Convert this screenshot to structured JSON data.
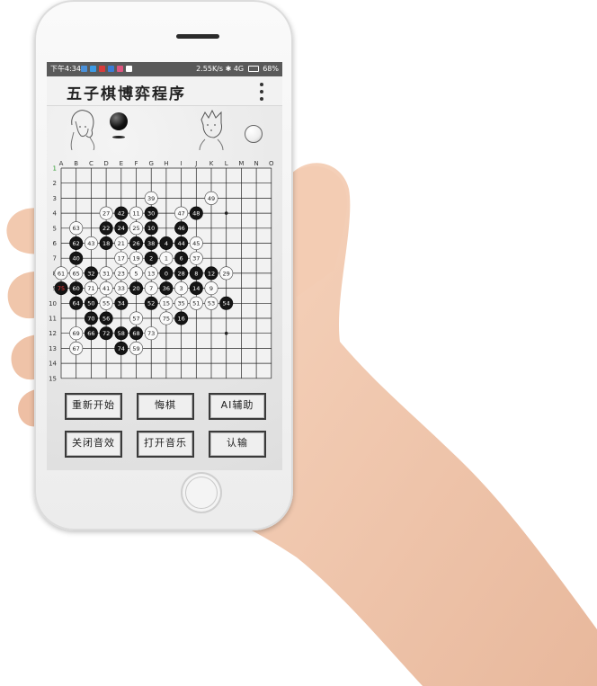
{
  "status_bar": {
    "time": "下午4:34",
    "network": "2.55K/s ✱ 4G",
    "battery": "68%",
    "notification_icons": [
      {
        "name": "message-icon",
        "color": "#4a90d9"
      },
      {
        "name": "app-icon",
        "color": "#3c9be6"
      },
      {
        "name": "mail-icon",
        "color": "#d83b3b"
      },
      {
        "name": "app2-icon",
        "color": "#3a7bd5"
      },
      {
        "name": "app3-icon",
        "color": "#e05580"
      },
      {
        "name": "signal-up-icon",
        "color": "#ffffff"
      }
    ]
  },
  "app": {
    "title": "五子棋博弈程序"
  },
  "players": {
    "player1_stone": "black",
    "player2_stone": "white"
  },
  "board": {
    "columns": [
      "A",
      "B",
      "C",
      "D",
      "E",
      "F",
      "G",
      "H",
      "I",
      "J",
      "K",
      "L",
      "M",
      "N",
      "O"
    ],
    "rows": [
      "1",
      "2",
      "3",
      "4",
      "5",
      "6",
      "7",
      "8",
      "9",
      "10",
      "11",
      "12",
      "13",
      "14",
      "15"
    ],
    "last_move": "75",
    "stones": [
      {
        "n": "39",
        "c": "white",
        "col": "G",
        "row": 3
      },
      {
        "n": "49",
        "c": "white",
        "col": "K",
        "row": 3
      },
      {
        "n": "27",
        "c": "white",
        "col": "D",
        "row": 4
      },
      {
        "n": "42",
        "c": "black",
        "col": "E",
        "row": 4
      },
      {
        "n": "11",
        "c": "white",
        "col": "F",
        "row": 4
      },
      {
        "n": "30",
        "c": "black",
        "col": "G",
        "row": 4
      },
      {
        "n": "47",
        "c": "white",
        "col": "I",
        "row": 4
      },
      {
        "n": "48",
        "c": "black",
        "col": "J",
        "row": 4
      },
      {
        "n": "63",
        "c": "white",
        "col": "B",
        "row": 5
      },
      {
        "n": "22",
        "c": "black",
        "col": "D",
        "row": 5
      },
      {
        "n": "24",
        "c": "black",
        "col": "E",
        "row": 5
      },
      {
        "n": "25",
        "c": "white",
        "col": "F",
        "row": 5
      },
      {
        "n": "10",
        "c": "black",
        "col": "G",
        "row": 5
      },
      {
        "n": "46",
        "c": "black",
        "col": "I",
        "row": 5
      },
      {
        "n": "62",
        "c": "black",
        "col": "B",
        "row": 6
      },
      {
        "n": "43",
        "c": "white",
        "col": "C",
        "row": 6
      },
      {
        "n": "18",
        "c": "black",
        "col": "D",
        "row": 6
      },
      {
        "n": "21",
        "c": "white",
        "col": "E",
        "row": 6
      },
      {
        "n": "26",
        "c": "black",
        "col": "F",
        "row": 6
      },
      {
        "n": "38",
        "c": "black",
        "col": "G",
        "row": 6
      },
      {
        "n": "4",
        "c": "black",
        "col": "H",
        "row": 6
      },
      {
        "n": "44",
        "c": "black",
        "col": "I",
        "row": 6
      },
      {
        "n": "45",
        "c": "white",
        "col": "J",
        "row": 6
      },
      {
        "n": "40",
        "c": "black",
        "col": "B",
        "row": 7
      },
      {
        "n": "17",
        "c": "white",
        "col": "E",
        "row": 7
      },
      {
        "n": "19",
        "c": "white",
        "col": "F",
        "row": 7
      },
      {
        "n": "2",
        "c": "black",
        "col": "G",
        "row": 7
      },
      {
        "n": "1",
        "c": "white",
        "col": "H",
        "row": 7
      },
      {
        "n": "6",
        "c": "black",
        "col": "I",
        "row": 7
      },
      {
        "n": "37",
        "c": "white",
        "col": "J",
        "row": 7
      },
      {
        "n": "61",
        "c": "white",
        "col": "A",
        "row": 8
      },
      {
        "n": "65",
        "c": "white",
        "col": "B",
        "row": 8
      },
      {
        "n": "32",
        "c": "black",
        "col": "C",
        "row": 8
      },
      {
        "n": "31",
        "c": "white",
        "col": "D",
        "row": 8
      },
      {
        "n": "23",
        "c": "white",
        "col": "E",
        "row": 8
      },
      {
        "n": "5",
        "c": "white",
        "col": "F",
        "row": 8
      },
      {
        "n": "13",
        "c": "white",
        "col": "G",
        "row": 8
      },
      {
        "n": "0",
        "c": "black",
        "col": "H",
        "row": 8
      },
      {
        "n": "28",
        "c": "black",
        "col": "I",
        "row": 8
      },
      {
        "n": "8",
        "c": "black",
        "col": "J",
        "row": 8
      },
      {
        "n": "12",
        "c": "black",
        "col": "K",
        "row": 8
      },
      {
        "n": "29",
        "c": "white",
        "col": "L",
        "row": 8
      },
      {
        "n": "75",
        "c": "black",
        "col": "A",
        "row": 9
      },
      {
        "n": "60",
        "c": "black",
        "col": "B",
        "row": 9
      },
      {
        "n": "71",
        "c": "white",
        "col": "C",
        "row": 9
      },
      {
        "n": "41",
        "c": "white",
        "col": "D",
        "row": 9
      },
      {
        "n": "33",
        "c": "white",
        "col": "E",
        "row": 9
      },
      {
        "n": "20",
        "c": "black",
        "col": "F",
        "row": 9
      },
      {
        "n": "7",
        "c": "white",
        "col": "G",
        "row": 9
      },
      {
        "n": "36",
        "c": "black",
        "col": "H",
        "row": 9
      },
      {
        "n": "3",
        "c": "white",
        "col": "I",
        "row": 9
      },
      {
        "n": "14",
        "c": "black",
        "col": "J",
        "row": 9
      },
      {
        "n": "9",
        "c": "white",
        "col": "K",
        "row": 9
      },
      {
        "n": "64",
        "c": "black",
        "col": "B",
        "row": 10
      },
      {
        "n": "50",
        "c": "black",
        "col": "C",
        "row": 10
      },
      {
        "n": "55",
        "c": "white",
        "col": "D",
        "row": 10
      },
      {
        "n": "34",
        "c": "black",
        "col": "E",
        "row": 10
      },
      {
        "n": "52",
        "c": "black",
        "col": "G",
        "row": 10
      },
      {
        "n": "15",
        "c": "white",
        "col": "H",
        "row": 10
      },
      {
        "n": "35",
        "c": "white",
        "col": "I",
        "row": 10
      },
      {
        "n": "51",
        "c": "white",
        "col": "J",
        "row": 10
      },
      {
        "n": "53",
        "c": "white",
        "col": "K",
        "row": 10
      },
      {
        "n": "54",
        "c": "black",
        "col": "L",
        "row": 10
      },
      {
        "n": "70",
        "c": "black",
        "col": "C",
        "row": 11
      },
      {
        "n": "56",
        "c": "black",
        "col": "D",
        "row": 11
      },
      {
        "n": "57",
        "c": "white",
        "col": "F",
        "row": 11
      },
      {
        "n": "75",
        "c": "white",
        "col": "H",
        "row": 11
      },
      {
        "n": "16",
        "c": "black",
        "col": "I",
        "row": 11
      },
      {
        "n": "69",
        "c": "white",
        "col": "B",
        "row": 12
      },
      {
        "n": "66",
        "c": "black",
        "col": "C",
        "row": 12
      },
      {
        "n": "72",
        "c": "black",
        "col": "D",
        "row": 12
      },
      {
        "n": "58",
        "c": "black",
        "col": "E",
        "row": 12
      },
      {
        "n": "68",
        "c": "black",
        "col": "F",
        "row": 12
      },
      {
        "n": "73",
        "c": "white",
        "col": "G",
        "row": 12
      },
      {
        "n": "67",
        "c": "white",
        "col": "B",
        "row": 13
      },
      {
        "n": "74",
        "c": "black",
        "col": "E",
        "row": 13
      },
      {
        "n": "59",
        "c": "white",
        "col": "F",
        "row": 13
      }
    ]
  },
  "buttons": {
    "restart": "重新开始",
    "undo": "悔棋",
    "ai_assist": "AI辅助",
    "sound_off": "关闭音效",
    "music_on": "打开音乐",
    "resign": "认输"
  }
}
